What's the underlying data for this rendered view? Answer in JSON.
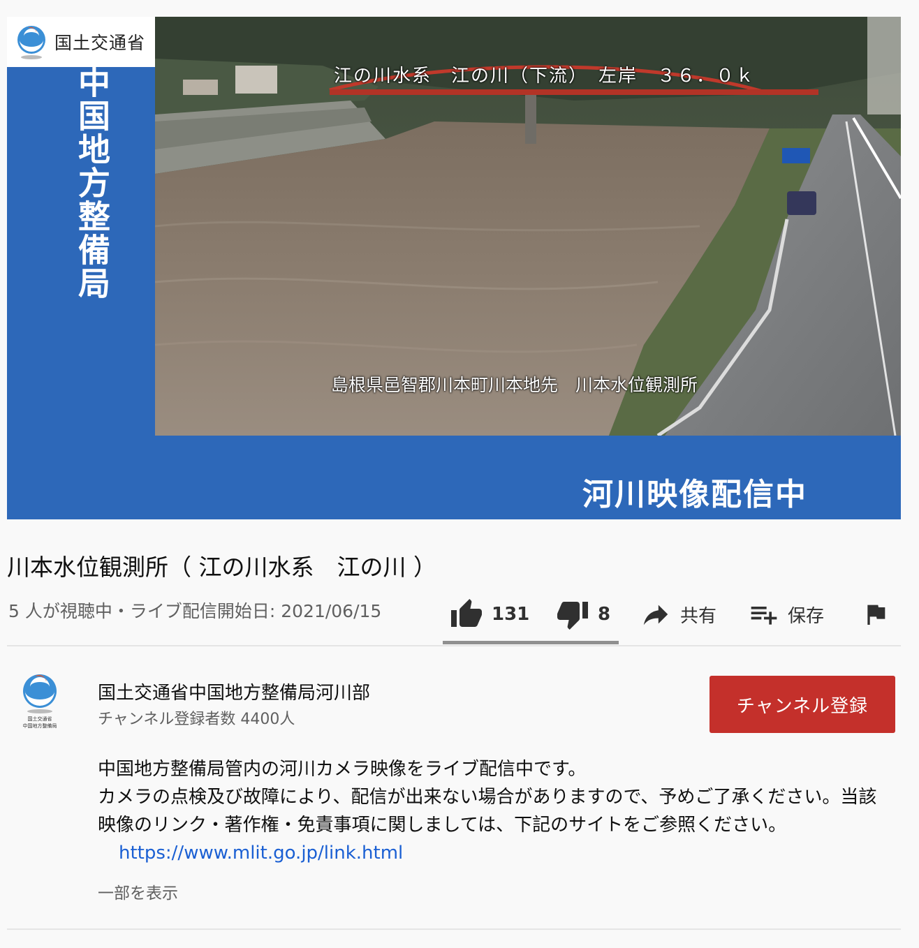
{
  "player": {
    "org_logo_text": "国土交通省",
    "vertical_title": "中国地方整備局",
    "camera_caption_top": "江の川水系　江の川（下流）　左岸　３６．０ｋ",
    "camera_caption_bottom": "島根県邑智郡川本町川本地先　川本水位観測所",
    "streaming_label": "河川映像配信中"
  },
  "video": {
    "title": "川本水位観測所（ 江の川水系　江の川 ）",
    "meta": "5 人が視聴中・ライブ配信開始日: 2021/06/15"
  },
  "actions": {
    "like_count": "131",
    "dislike_count": "8",
    "share_label": "共有",
    "save_label": "保存",
    "like_ratio": 0.942
  },
  "channel": {
    "name": "国土交通省中国地方整備局河川部",
    "subscribers": "チャンネル登録者数 4400人",
    "avatar_caption_line1": "国土交通省",
    "avatar_caption_line2": "中国地方整備局",
    "subscribe_label": "チャンネル登録"
  },
  "description": {
    "line1": "中国地方整備局管内の河川カメラ映像をライブ配信中です。",
    "line2": "カメラの点検及び故障により、配信が出来ない場合がありますので、予めご了承ください。当該映像のリンク・著作権・免責事項に関しましては、下記のサイトをご参照ください。",
    "link": "https://www.mlit.go.jp/link.html",
    "show_more": "一部を表示"
  },
  "colors": {
    "player_blue": "#2d68b9",
    "subscribe_red": "#c4302b",
    "link_blue": "#1a5fd3"
  },
  "icons": [
    "mlit-logo-icon",
    "thumbs-up-icon",
    "thumbs-down-icon",
    "share-icon",
    "playlist-add-icon",
    "flag-icon"
  ]
}
